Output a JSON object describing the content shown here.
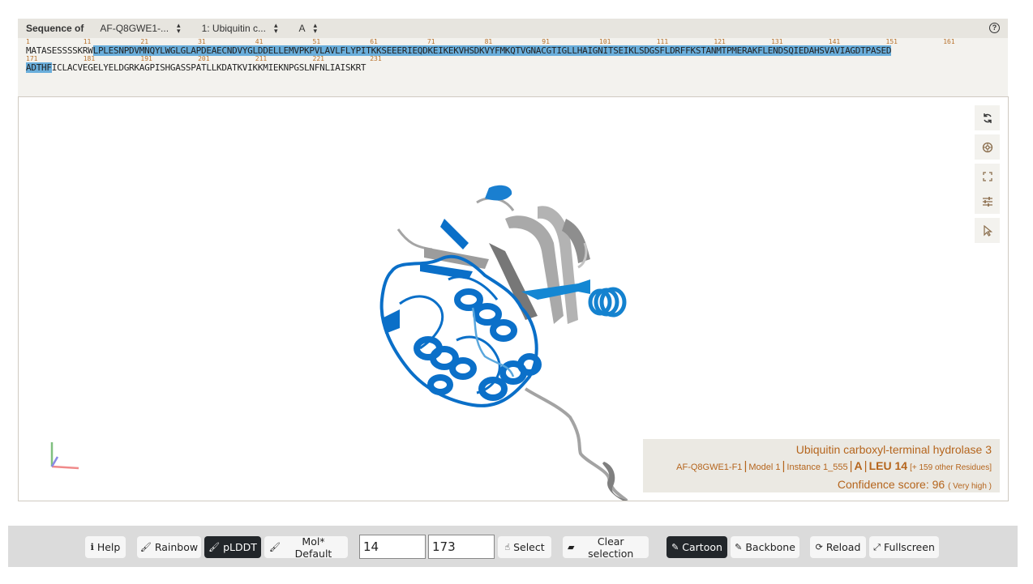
{
  "sequence_panel": {
    "label": "Sequence of",
    "selects": [
      {
        "value": "AF-Q8GWE1-..."
      },
      {
        "value": "1: Ubiquitin c..."
      },
      {
        "value": "A"
      }
    ],
    "help_icon": "question-circle-icon",
    "line1": {
      "pre": "MATASESSSSKRW",
      "highlighted": "LPLESNPDVMNQYLWGLGLAPDEAECNDVYGLDDELLEMVPKPVLAVLFLYPITKKSEEERIEQDKEIKEKVHSDKVYFMKQTVGNACGTIGLLHAIGNITSEIKLSDGSFLDRFFKSTANMTPMERAKFLENDSQIEDAHSVAVIAGDTPASED",
      "numbers": [
        "1",
        "11",
        "21",
        "31",
        "41",
        "51",
        "61",
        "71",
        "81",
        "91",
        "101",
        "111",
        "121",
        "131",
        "141",
        "151",
        "161"
      ]
    },
    "line2": {
      "highlighted": "ADTHF",
      "post": "ICLACVEGELYELDGRKAGPISHGASSPATLLKDATKVIKKMIEKNPGSLNFNLIAISKRT",
      "numbers": [
        "171",
        "181",
        "191",
        "201",
        "211",
        "221",
        "231"
      ]
    },
    "highlight_color": "#6aaedb"
  },
  "viewer": {
    "controls": [
      {
        "name": "reset-camera-icon",
        "glyph": "⟳"
      },
      {
        "name": "screenshot-icon",
        "glyph": "◎"
      },
      {
        "name": "expand-icon",
        "glyph": "⛶"
      },
      {
        "name": "settings-sliders-icon",
        "glyph": "☷"
      },
      {
        "name": "selection-mode-icon",
        "glyph": "⇱"
      }
    ],
    "info": {
      "title": "Ubiquitin carboxyl-terminal hydrolase 3",
      "entry": "AF-Q8GWE1-F1",
      "model": "Model 1",
      "instance": "Instance 1_555",
      "chain": "A",
      "residue": "LEU 14",
      "others": "[+ 159 other Residues]",
      "confidence_label": "Confidence score: 96",
      "confidence_level": "( Very high )"
    },
    "colors": {
      "very_high": "#0a6fc8",
      "confident": "#36a0dc",
      "unselected": "#9b9b9b"
    }
  },
  "toolbar": {
    "help": "Help",
    "rainbow": "Rainbow",
    "plddt": "pLDDT",
    "mol_default": "Mol* Default",
    "start_value": "14",
    "end_value": "173",
    "select": "Select",
    "clear_selection": "Clear selection",
    "cartoon": "Cartoon",
    "backbone": "Backbone",
    "reload": "Reload",
    "fullscreen": "Fullscreen"
  }
}
